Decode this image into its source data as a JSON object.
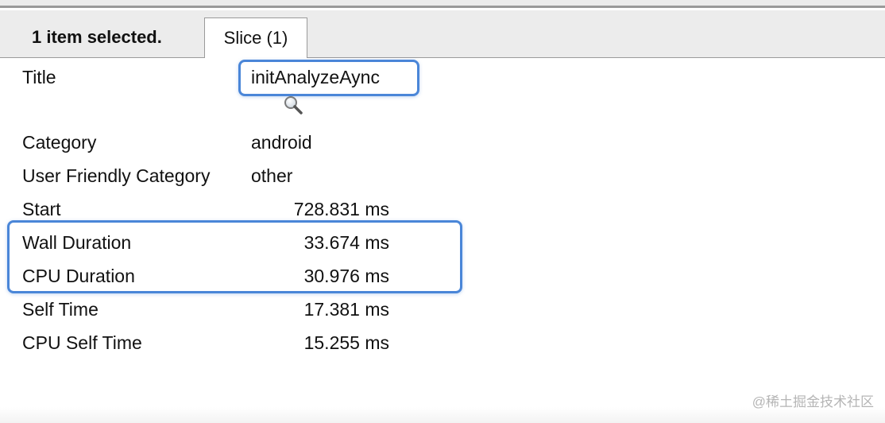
{
  "header": {
    "selection_text": "1 item selected.",
    "tab_label": "Slice (1)"
  },
  "details": {
    "title": {
      "label": "Title",
      "value": "initAnalyzeAync"
    },
    "category": {
      "label": "Category",
      "value": "android"
    },
    "user_friendly_category": {
      "label": "User Friendly Category",
      "value": "other"
    },
    "start": {
      "label": "Start",
      "value": "728.831 ms"
    },
    "wall_duration": {
      "label": "Wall Duration",
      "value": "33.674 ms"
    },
    "cpu_duration": {
      "label": "CPU Duration",
      "value": "30.976 ms"
    },
    "self_time": {
      "label": "Self Time",
      "value": "17.381 ms"
    },
    "cpu_self_time": {
      "label": "CPU Self Time",
      "value": "15.255 ms"
    }
  },
  "icons": {
    "search": "magnifier-icon"
  },
  "colors": {
    "highlight": "#4a86d8"
  },
  "watermark": "@稀土掘金技术社区"
}
